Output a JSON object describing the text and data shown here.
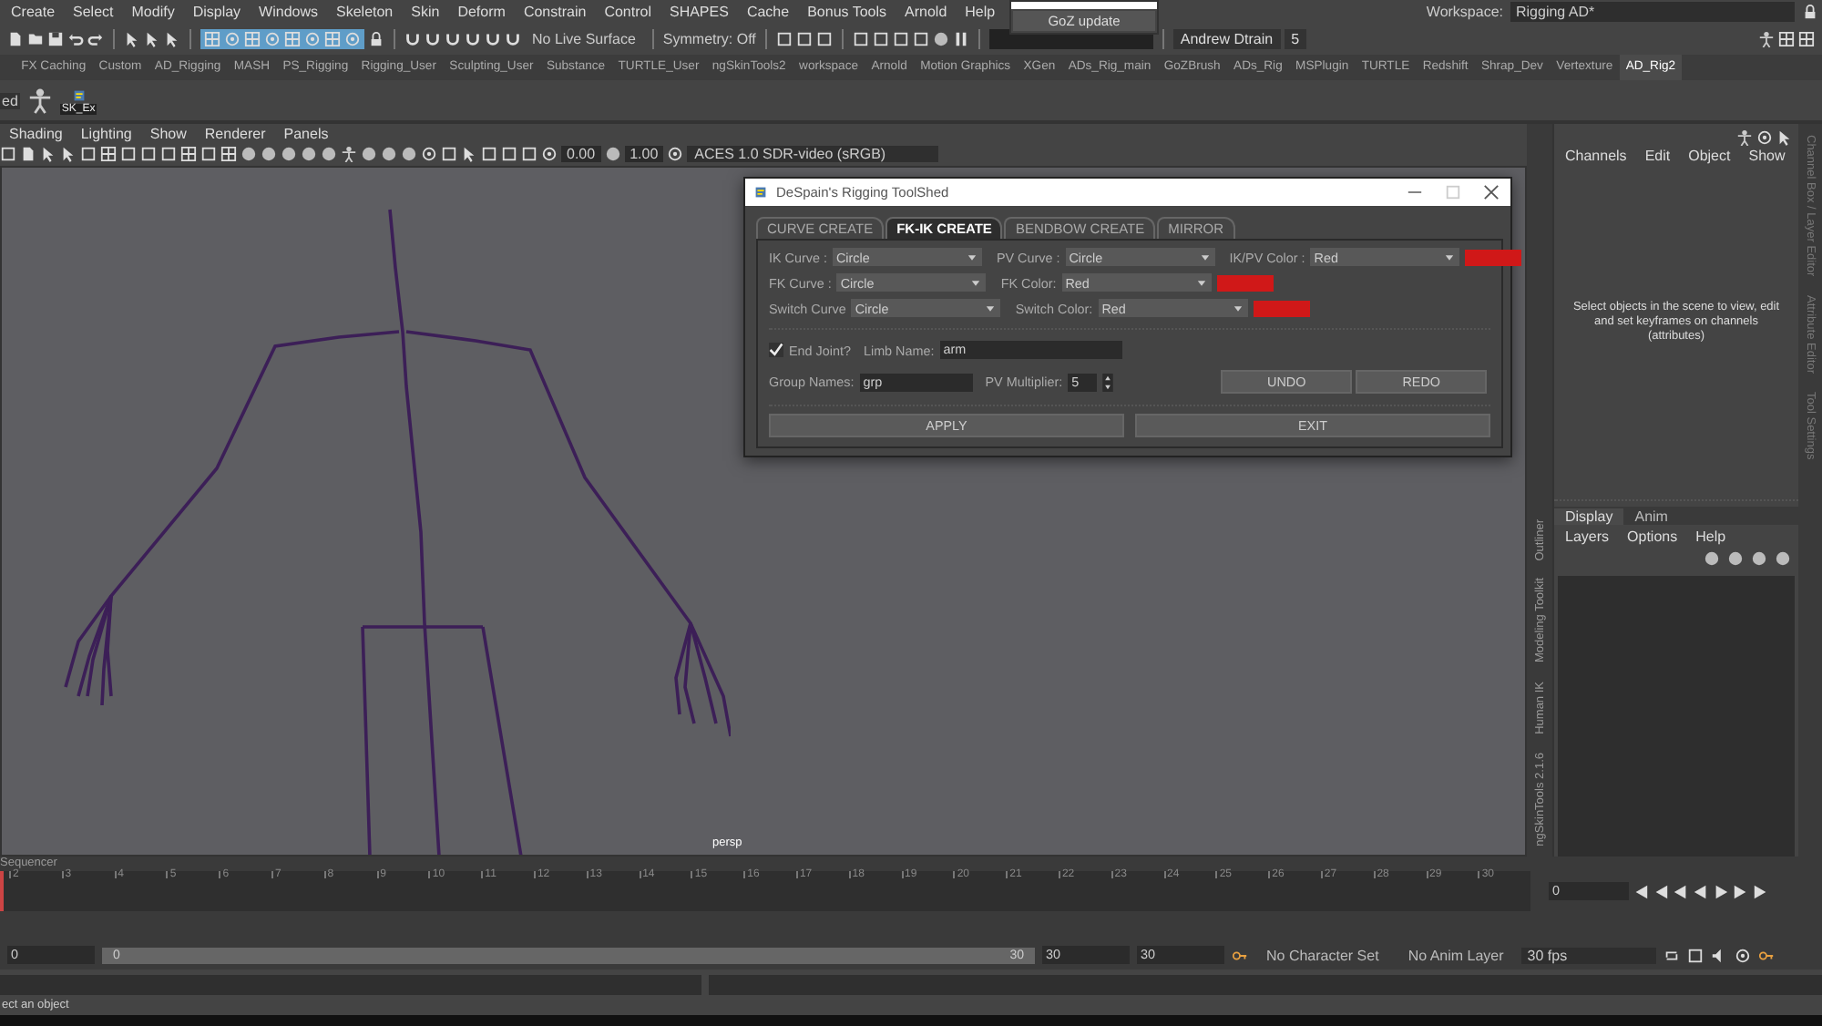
{
  "menubar": {
    "items": [
      "Create",
      "Select",
      "Modify",
      "Display",
      "Windows",
      "Skeleton",
      "Skin",
      "Deform",
      "Constrain",
      "Control",
      "SHAPES",
      "Cache",
      "Bonus Tools",
      "Arnold",
      "Help"
    ],
    "workspace_label": "Workspace:",
    "workspace_value": "Rigging AD*"
  },
  "popup": {
    "button": "GoZ update"
  },
  "status_line": {
    "live_surface": "No Live Surface",
    "symmetry": "Symmetry: Off",
    "user": "Andrew Dtrain",
    "notifications": "5"
  },
  "shelf_tabs": [
    {
      "label": "FX Caching",
      "selected": false
    },
    {
      "label": "Custom",
      "selected": false
    },
    {
      "label": "AD_Rigging",
      "selected": false
    },
    {
      "label": "MASH",
      "selected": false
    },
    {
      "label": "PS_Rigging",
      "selected": false
    },
    {
      "label": "Rigging_User",
      "selected": false
    },
    {
      "label": "Sculpting_User",
      "selected": false
    },
    {
      "label": "Substance",
      "selected": false
    },
    {
      "label": "TURTLE_User",
      "selected": false
    },
    {
      "label": "ngSkinTools2",
      "selected": false
    },
    {
      "label": "workspace",
      "selected": false
    },
    {
      "label": "Arnold",
      "selected": false
    },
    {
      "label": "Motion Graphics",
      "selected": false
    },
    {
      "label": "XGen",
      "selected": false
    },
    {
      "label": "ADs_Rig_main",
      "selected": false
    },
    {
      "label": "GoZBrush",
      "selected": false
    },
    {
      "label": "ADs_Rig",
      "selected": false
    },
    {
      "label": "MSPlugin",
      "selected": false
    },
    {
      "label": "TURTLE",
      "selected": false
    },
    {
      "label": "Redshift",
      "selected": false
    },
    {
      "label": "Shrap_Dev",
      "selected": false
    },
    {
      "label": "Vertexture",
      "selected": false
    },
    {
      "label": "AD_Rig2",
      "selected": true
    }
  ],
  "shelf": {
    "buttons": [
      "ed",
      "SK_Ex"
    ]
  },
  "viewport": {
    "menu": [
      "Shading",
      "Lighting",
      "Show",
      "Renderer",
      "Panels"
    ],
    "exposure": "0.00",
    "gamma": "1.00",
    "color_space": "ACES 1.0 SDR-video (sRGB)",
    "camera": "persp"
  },
  "dialog": {
    "title": "DeSpain's Rigging ToolShed",
    "tabs": [
      {
        "label": "CURVE CREATE",
        "selected": false
      },
      {
        "label": "FK-IK CREATE",
        "selected": true
      },
      {
        "label": "BENDBOW CREATE",
        "selected": false
      },
      {
        "label": "MIRROR",
        "selected": false
      }
    ],
    "rows": [
      [
        {
          "kind": "dropdown",
          "label": "IK Curve :",
          "value": "Circle"
        },
        {
          "kind": "dropdown",
          "label": "PV Curve :",
          "value": "Circle"
        },
        {
          "kind": "color",
          "label": "IK/PV Color :",
          "value": "Red",
          "color": "#d01818"
        }
      ],
      [
        {
          "kind": "dropdown",
          "label": "FK Curve :",
          "value": "Circle"
        },
        {
          "kind": "color",
          "label": "FK Color:",
          "value": "Red",
          "color": "#d01818"
        }
      ],
      [
        {
          "kind": "dropdown",
          "label": "Switch Curve",
          "value": "Circle"
        },
        {
          "kind": "color",
          "label": "Switch Color:",
          "value": "Red",
          "color": "#d01818"
        }
      ]
    ],
    "end_joint": {
      "label": "End Joint?",
      "checked": true
    },
    "limb_name": {
      "label": "Limb Name:",
      "value": "arm"
    },
    "group_names": {
      "label": "Group Names:",
      "value": "grp"
    },
    "pv_multiplier": {
      "label": "PV Multiplier:",
      "value": "5"
    },
    "buttons": [
      "UNDO",
      "REDO"
    ],
    "footer_buttons": [
      "APPLY",
      "EXIT"
    ]
  },
  "side_tabs": [
    "Outliner",
    "Modeling Toolkit",
    "Human IK",
    "ngSkinTools 2.1.6"
  ],
  "channel_box": {
    "menu": [
      "Channels",
      "Edit",
      "Object",
      "Show"
    ],
    "message": "Select objects in the scene to view, edit and set keyframes on channels (attributes)"
  },
  "layer_editor": {
    "tabs": [
      {
        "label": "Display",
        "selected": true
      },
      {
        "label": "Anim",
        "selected": false
      }
    ],
    "menu": [
      "Layers",
      "Options",
      "Help"
    ]
  },
  "right_tabs": [
    "Channel Box / Layer Editor",
    "Attribute Editor",
    "Tool Settings"
  ],
  "timeline": {
    "label": "Sequencer",
    "ticks": [
      "2",
      "3",
      "4",
      "5",
      "6",
      "7",
      "8",
      "9",
      "10",
      "11",
      "12",
      "13",
      "14",
      "15",
      "16",
      "17",
      "18",
      "19",
      "20",
      "21",
      "22",
      "23",
      "24",
      "25",
      "26",
      "27",
      "28",
      "29",
      "30"
    ],
    "current_frame": "0",
    "level": 0
  },
  "range": {
    "level": 1,
    "start": "0",
    "range_start": "0",
    "range_end": "30",
    "end": "30",
    "anim_end": "30",
    "character_set": "No Character Set",
    "anim_layer": "No Anim Layer",
    "fps": "30 fps"
  },
  "help_line": "ect an object"
}
